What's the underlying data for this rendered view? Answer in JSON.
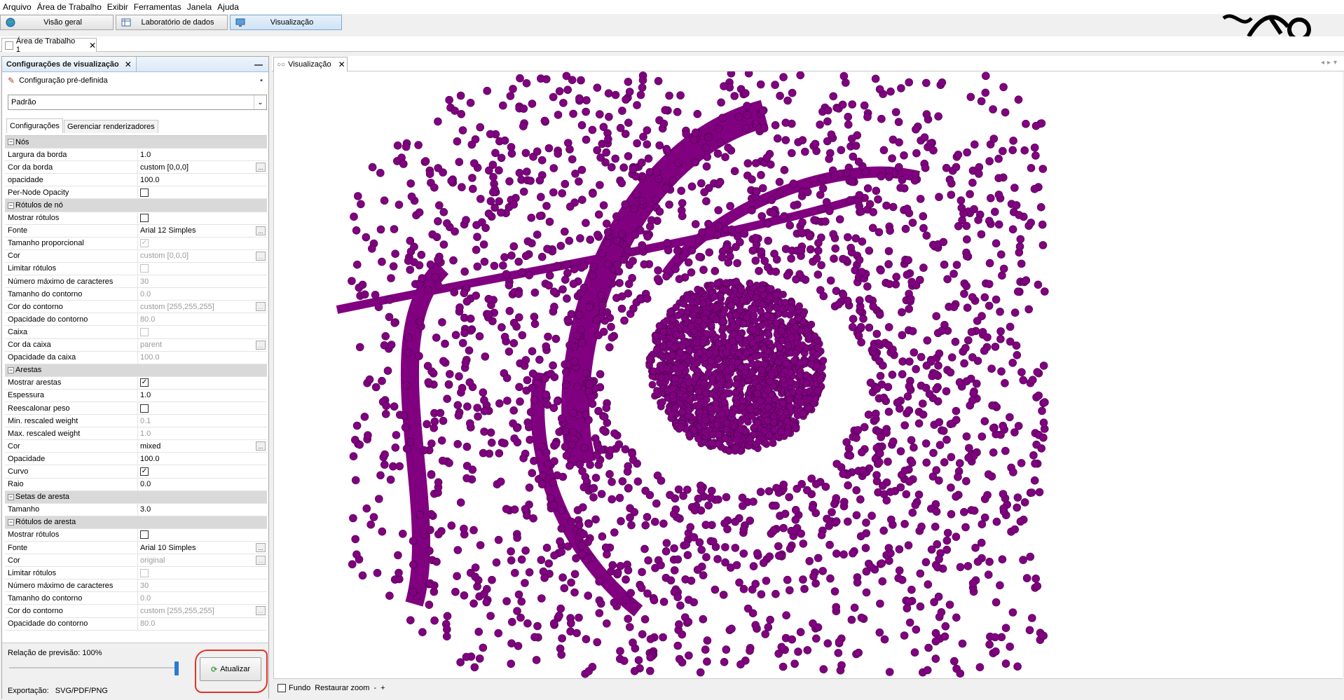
{
  "menu": [
    "Arquivo",
    "Área de Trabalho",
    "Exibir",
    "Ferramentas",
    "Janela",
    "Ajuda"
  ],
  "top_buttons": [
    {
      "label": "Visão geral",
      "icon": "globe-icon"
    },
    {
      "label": "Laboratório de dados",
      "icon": "table-icon"
    },
    {
      "label": "Visualização",
      "icon": "monitor-icon"
    }
  ],
  "workspace_tab": "Área de Trabalho 1",
  "panel": {
    "title": "Configurações de visualização",
    "preset_label": "Configuração pré-definida",
    "preset_value": "Padrão",
    "tabs": [
      "Configurações",
      "Gerenciar renderizadores"
    ]
  },
  "properties": [
    {
      "type": "cat",
      "name": "Nós"
    },
    {
      "type": "text",
      "name": "Largura da borda",
      "value": "1.0"
    },
    {
      "type": "text",
      "name": "Cor da borda",
      "value": "custom [0,0,0]",
      "ellipsis": true
    },
    {
      "type": "text",
      "name": "opacidade",
      "value": "100.0"
    },
    {
      "type": "check",
      "name": "Per-Node Opacity",
      "value": "",
      "checked": false
    },
    {
      "type": "cat",
      "name": "Rótulos de nó"
    },
    {
      "type": "check",
      "name": "Mostrar rótulos",
      "value": "",
      "checked": false
    },
    {
      "type": "text",
      "name": "Fonte",
      "value": "Arial 12 Simples",
      "ellipsis": true
    },
    {
      "type": "check",
      "name": "Tamanho proporcional",
      "value": "",
      "checked": true,
      "disabled": true
    },
    {
      "type": "text",
      "name": "Cor",
      "value": "custom [0,0,0]",
      "ellipsis": true,
      "disabled": true
    },
    {
      "type": "check",
      "name": "Limitar rótulos",
      "value": "",
      "checked": false,
      "disabled": true
    },
    {
      "type": "text",
      "name": "Número máximo de caracteres",
      "value": "30",
      "disabled": true
    },
    {
      "type": "text",
      "name": "Tamanho do contorno",
      "value": "0.0",
      "disabled": true
    },
    {
      "type": "text",
      "name": "Cor do contorno",
      "value": "custom [255,255,255]",
      "ellipsis": true,
      "disabled": true
    },
    {
      "type": "text",
      "name": "Opacidade do contorno",
      "value": "80.0",
      "disabled": true
    },
    {
      "type": "check",
      "name": "Caixa",
      "value": "",
      "checked": false,
      "disabled": true
    },
    {
      "type": "text",
      "name": "Cor da caixa",
      "value": "parent",
      "ellipsis": true,
      "disabled": true
    },
    {
      "type": "text",
      "name": "Opacidade da caixa",
      "value": "100.0",
      "disabled": true
    },
    {
      "type": "cat",
      "name": "Arestas"
    },
    {
      "type": "check",
      "name": "Mostrar arestas",
      "value": "",
      "checked": true
    },
    {
      "type": "text",
      "name": "Espessura",
      "value": "1.0"
    },
    {
      "type": "check",
      "name": "Reescalonar peso",
      "value": "",
      "checked": false
    },
    {
      "type": "text",
      "name": "Min. rescaled weight",
      "value": "0.1",
      "disabled": true
    },
    {
      "type": "text",
      "name": "Max. rescaled weight",
      "value": "1.0",
      "disabled": true
    },
    {
      "type": "text",
      "name": "Cor",
      "value": "mixed",
      "ellipsis": true
    },
    {
      "type": "text",
      "name": "Opacidade",
      "value": "100.0"
    },
    {
      "type": "check",
      "name": "Curvo",
      "value": "",
      "checked": true
    },
    {
      "type": "text",
      "name": "Raio",
      "value": "0.0"
    },
    {
      "type": "cat",
      "name": "Setas de aresta"
    },
    {
      "type": "text",
      "name": "Tamanho",
      "value": "3.0"
    },
    {
      "type": "cat",
      "name": "Rótulos de aresta"
    },
    {
      "type": "check",
      "name": "Mostrar rótulos",
      "value": "",
      "checked": false
    },
    {
      "type": "text",
      "name": "Fonte",
      "value": "Arial 10 Simples",
      "ellipsis": true
    },
    {
      "type": "text",
      "name": "Cor",
      "value": "original",
      "ellipsis": true,
      "disabled": true
    },
    {
      "type": "check",
      "name": "Limitar rótulos",
      "value": "",
      "checked": false,
      "disabled": true
    },
    {
      "type": "text",
      "name": "Número máximo de caracteres",
      "value": "30",
      "disabled": true
    },
    {
      "type": "text",
      "name": "Tamanho do contorno",
      "value": "0.0",
      "disabled": true
    },
    {
      "type": "text",
      "name": "Cor do contorno",
      "value": "custom [255,255,255]",
      "ellipsis": true,
      "disabled": true
    },
    {
      "type": "text",
      "name": "Opacidade do contorno",
      "value": "80.0",
      "disabled": true
    }
  ],
  "footer": {
    "ratio_label": "Relação de previsão:",
    "ratio_value": "100%",
    "update_label": "Atualizar",
    "export_label": "Exportação:",
    "export_formats": "SVG/PDF/PNG",
    "slider_fraction": 1.0
  },
  "viz_tab": "Visualização",
  "viz_bottom": {
    "background_label": "Fundo",
    "reset_zoom": "Restaurar zoom",
    "minus": "-",
    "plus": "+"
  },
  "graph_color": "#800080",
  "accent_color": "#e0332b"
}
